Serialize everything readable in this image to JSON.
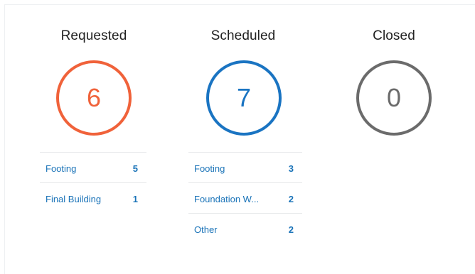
{
  "colors": {
    "requested": "#f0623a",
    "scheduled": "#1a74c2",
    "closed": "#6b6b6b",
    "link": "#1a73b8"
  },
  "columns": [
    {
      "title": "Requested",
      "count": "6",
      "items": [
        {
          "label": "Footing",
          "count": "5"
        },
        {
          "label": "Final Building",
          "count": "1"
        }
      ]
    },
    {
      "title": "Scheduled",
      "count": "7",
      "items": [
        {
          "label": "Footing",
          "count": "3"
        },
        {
          "label": "Foundation W...",
          "count": "2"
        },
        {
          "label": "Other",
          "count": "2"
        }
      ]
    },
    {
      "title": "Closed",
      "count": "0",
      "items": []
    }
  ]
}
